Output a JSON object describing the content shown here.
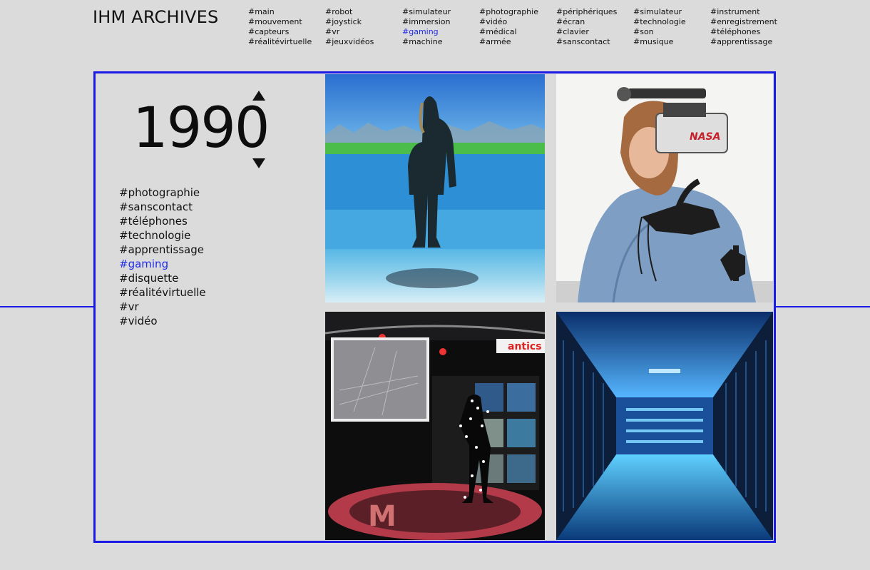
{
  "site": {
    "title": "IHM ARCHIVES"
  },
  "nav": {
    "columns": [
      [
        "#main",
        "#mouvement",
        "#capteurs",
        "#réalitévirtuelle"
      ],
      [
        "#robot",
        "#joystick",
        "#vr",
        "#jeuxvidéos"
      ],
      [
        "#simulateur",
        "#immersion",
        "#gaming",
        "#machine"
      ],
      [
        "#photographie",
        "#vidéo",
        "#médical",
        "#armée"
      ],
      [
        "#périphériques",
        "#écran",
        "#clavier",
        "#sanscontact"
      ],
      [
        "#simulateur",
        "#technologie",
        "#son",
        "#musique"
      ],
      [
        "#instrument",
        "#enregistrement",
        "#téléphones",
        "#apprentissage"
      ]
    ],
    "active_tag": "#gaming"
  },
  "entry": {
    "year": "1990",
    "tags": [
      "#photographie",
      "#sanscontact",
      "#téléphones",
      "#technologie",
      "#apprentissage",
      "#gaming",
      "#disquette",
      "#réalitévirtuelle",
      "#vr",
      "#vidéo"
    ],
    "active_tag": "#gaming",
    "images": {
      "img2": {
        "helmet_logo": "NASA"
      },
      "img3": {
        "banner_text": "antics",
        "floor_logo": "M"
      }
    }
  },
  "colors": {
    "accent": "#1a1ae6",
    "background": "#dcdbdc",
    "text": "#111111"
  }
}
